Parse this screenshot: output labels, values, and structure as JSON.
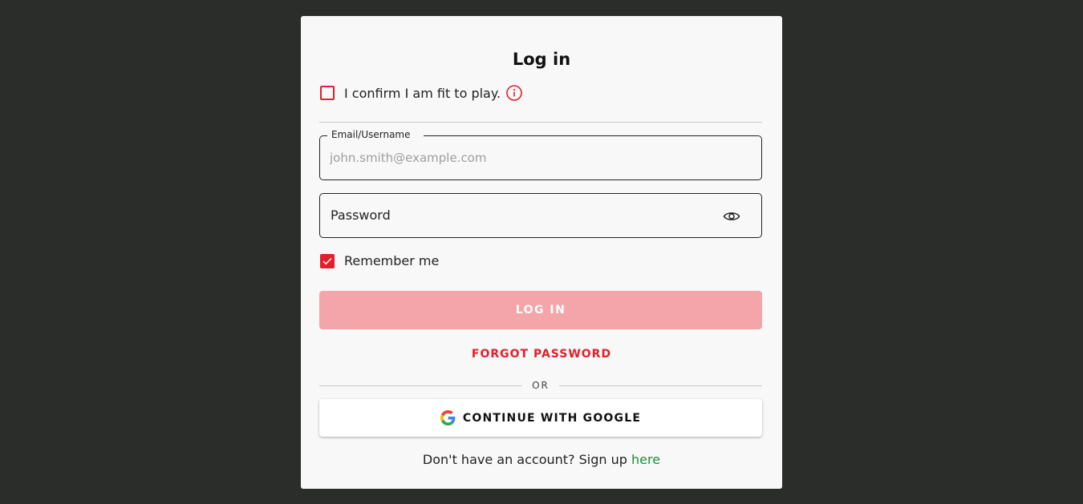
{
  "colors": {
    "background": "#2a2d2a",
    "card": "#f8f8f8",
    "accent_red": "#e0202a",
    "disabled_button": "#f4a5a9",
    "link_green": "#1e8c3a"
  },
  "login": {
    "title": "Log in",
    "fit_checkbox": {
      "label": "I confirm I am fit to play.",
      "checked": false,
      "icon": "info-icon"
    },
    "email": {
      "legend": "Email/Username",
      "placeholder": "john.smith@example.com",
      "value": ""
    },
    "password": {
      "label": "Password",
      "icon": "eye-icon"
    },
    "remember": {
      "label": "Remember me",
      "checked": true
    },
    "login_button": "LOG IN",
    "forgot_password": "FORGOT PASSWORD",
    "or_text": "OR",
    "google_button": {
      "label": "CONTINUE WITH GOOGLE",
      "icon": "google-logo-icon"
    },
    "signup": {
      "text": "Don't have an account? Sign up",
      "link": "here"
    }
  }
}
